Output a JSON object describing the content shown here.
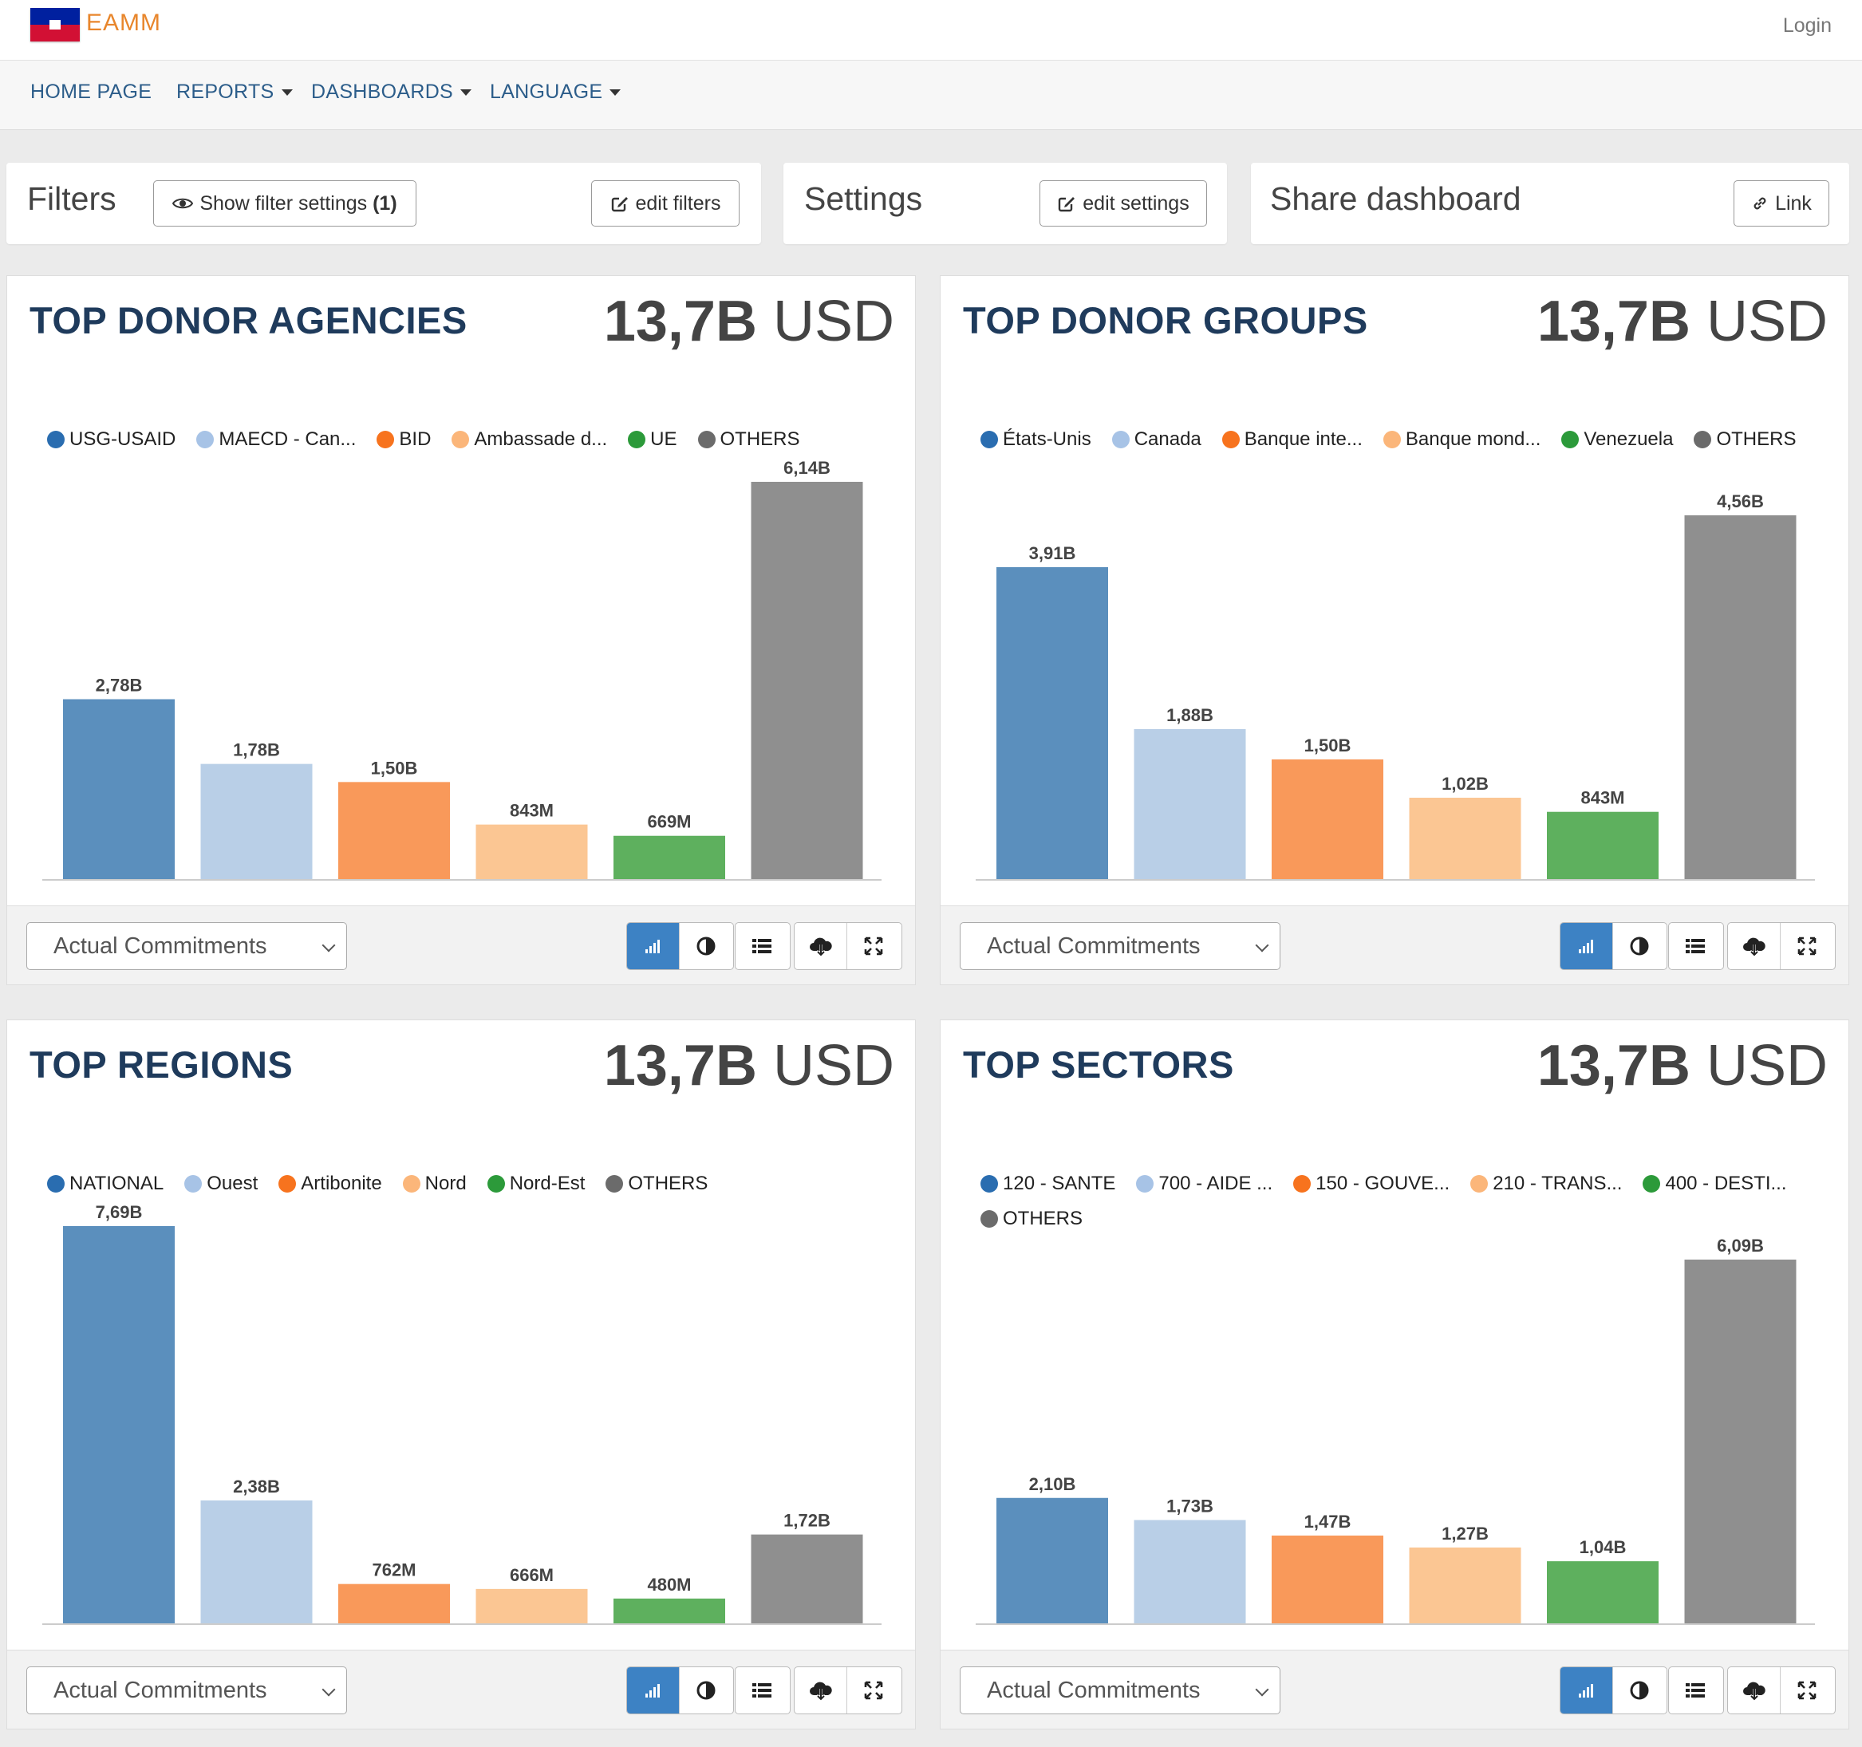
{
  "app": {
    "brand": "EAMM",
    "login": "Login"
  },
  "nav": {
    "home": "HOME PAGE",
    "reports": "REPORTS",
    "dashboards": "DASHBOARDS",
    "language": "LANGUAGE"
  },
  "filters": {
    "title": "Filters",
    "show_label": "Show filter settings",
    "show_count": "(1)",
    "edit_label": "edit filters"
  },
  "settings": {
    "title": "Settings",
    "edit_label": "edit settings"
  },
  "share": {
    "title": "Share dashboard",
    "link_label": "Link"
  },
  "colors": [
    "#5b8fbd",
    "#b9cfe7",
    "#f9995a",
    "#fbc693",
    "#5eb05e",
    "#8f8f8f"
  ],
  "legend_colors": [
    "#2a6db0",
    "#a7c3e6",
    "#f7731e",
    "#fbb67a",
    "#2c9a3a",
    "#6b6b6b"
  ],
  "panels": [
    {
      "title": "TOP DONOR AGENCIES",
      "total_num": "13,7B",
      "total_unit": "USD",
      "measure": "Actual Commitments",
      "legend": [
        "USG-USAID",
        "MAECD - Can...",
        "BID",
        "Ambassade d...",
        "UE",
        "OTHERS"
      ]
    },
    {
      "title": "TOP DONOR GROUPS",
      "total_num": "13,7B",
      "total_unit": "USD",
      "measure": "Actual Commitments",
      "legend": [
        "États-Unis",
        "Canada",
        "Banque inte...",
        "Banque mond...",
        "Venezuela",
        "OTHERS"
      ]
    },
    {
      "title": "TOP REGIONS",
      "total_num": "13,7B",
      "total_unit": "USD",
      "measure": "Actual Commitments",
      "legend": [
        "NATIONAL",
        "Ouest",
        "Artibonite",
        "Nord",
        "Nord-Est",
        "OTHERS"
      ]
    },
    {
      "title": "TOP SECTORS",
      "total_num": "13,7B",
      "total_unit": "USD",
      "measure": "Actual Commitments",
      "legend": [
        "120 - SANTE",
        "700 - AIDE ...",
        "150 - GOUVE...",
        "210 - TRANS...",
        "400 - DESTI...",
        "OTHERS"
      ]
    }
  ],
  "chart_data": [
    {
      "type": "bar",
      "title": "TOP DONOR AGENCIES",
      "categories": [
        "USG-USAID",
        "MAECD - Can...",
        "BID",
        "Ambassade d...",
        "UE",
        "OTHERS"
      ],
      "values": [
        2.78,
        1.78,
        1.5,
        0.843,
        0.669,
        6.14
      ],
      "labels": [
        "2,78B",
        "1,78B",
        "1,50B",
        "843M",
        "669M",
        "6,14B"
      ],
      "unit": "B USD",
      "ylim": [
        0,
        6.14
      ],
      "grid": false,
      "legend_position": "top"
    },
    {
      "type": "bar",
      "title": "TOP DONOR GROUPS",
      "categories": [
        "États-Unis",
        "Canada",
        "Banque inte...",
        "Banque mond...",
        "Venezuela",
        "OTHERS"
      ],
      "values": [
        3.91,
        1.88,
        1.5,
        1.02,
        0.843,
        4.56
      ],
      "labels": [
        "3,91B",
        "1,88B",
        "1,50B",
        "1,02B",
        "843M",
        "4,56B"
      ],
      "unit": "B USD",
      "ylim": [
        0,
        4.56
      ],
      "grid": false,
      "legend_position": "top"
    },
    {
      "type": "bar",
      "title": "TOP REGIONS",
      "categories": [
        "NATIONAL",
        "Ouest",
        "Artibonite",
        "Nord",
        "Nord-Est",
        "OTHERS"
      ],
      "values": [
        7.69,
        2.38,
        0.762,
        0.666,
        0.48,
        1.72
      ],
      "labels": [
        "7,69B",
        "2,38B",
        "762M",
        "666M",
        "480M",
        "1,72B"
      ],
      "unit": "B USD",
      "ylim": [
        0,
        7.69
      ],
      "grid": false,
      "legend_position": "top"
    },
    {
      "type": "bar",
      "title": "TOP SECTORS",
      "categories": [
        "120 - SANTE",
        "700 - AIDE ...",
        "150 - GOUVE...",
        "210 - TRANS...",
        "400 - DESTI...",
        "OTHERS"
      ],
      "values": [
        2.1,
        1.73,
        1.47,
        1.27,
        1.04,
        6.09
      ],
      "labels": [
        "2,10B",
        "1,73B",
        "1,47B",
        "1,27B",
        "1,04B",
        "6,09B"
      ],
      "unit": "B USD",
      "ylim": [
        0,
        6.09
      ],
      "grid": false,
      "legend_position": "top"
    }
  ]
}
